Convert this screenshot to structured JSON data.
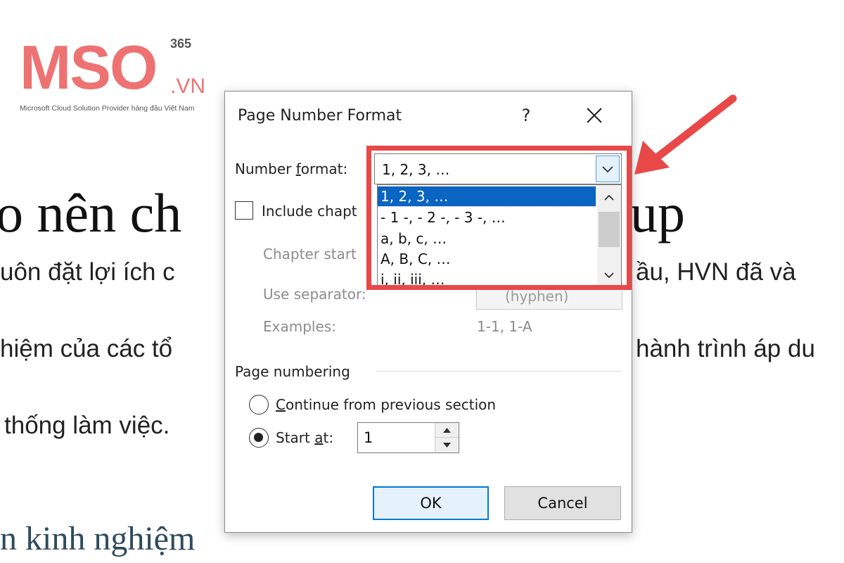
{
  "logo": {
    "brand": "MSO",
    "superscript": "365",
    "domain_suffix": ".VN",
    "tagline": "Microsoft Cloud Solution Provider hàng đầu Việt Nam"
  },
  "background_doc": {
    "heading": "o nên ch",
    "heading_right": "up",
    "line1_left": "uôn đặt lợi ích c",
    "line1_right": "ầu, HVN đã và",
    "line2_left": "hiệm của các tổ",
    "line2_right": "hành trình áp du",
    "line3_left": "thống làm việc.",
    "subheading": "n kinh nghiệm"
  },
  "dialog": {
    "title": "Page Number Format",
    "help_label": "?",
    "number_format": {
      "label_pre": "Number ",
      "label_accel": "f",
      "label_post": "ormat:",
      "value": "1, 2, 3, …",
      "options": [
        "1, 2, 3, …",
        "- 1 -, - 2 -, - 3 -, …",
        "a, b, c, …",
        "A, B, C, …",
        "i, ii, iii, …"
      ],
      "selected_index": 0
    },
    "include_chapter_label": "Include chapt",
    "chapter_starts_label": "Chapter start",
    "use_separator_label": "Use separator:",
    "separator_value": "(hyphen)",
    "examples_label": "Examples:",
    "examples_value": "1-1, 1-A",
    "page_numbering": {
      "group_label": "Page numbering",
      "continue_accel": "C",
      "continue_rest": "ontinue from previous section",
      "start_at_pre": "Start ",
      "start_at_accel": "a",
      "start_at_post": "t:",
      "start_at_value": "1",
      "selected": "start_at"
    },
    "ok_label": "OK",
    "cancel_label": "Cancel"
  },
  "colors": {
    "annotation_red": "#e84848",
    "selection_blue": "#0a64c2",
    "logo_coral": "#ee7272"
  }
}
